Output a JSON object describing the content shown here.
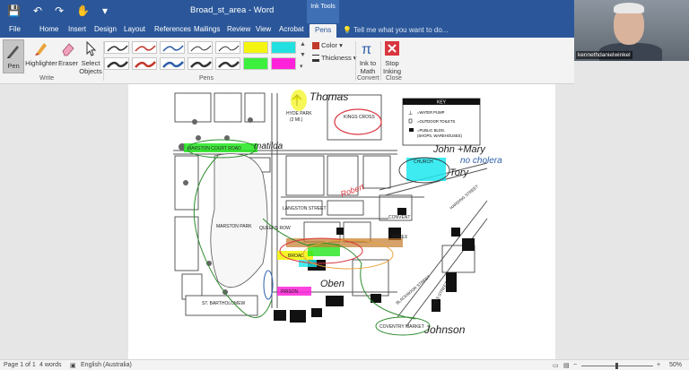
{
  "titlebar": {
    "doc_title": "Broad_st_area - Word",
    "context_tab": "Ink Tools",
    "qat": {
      "save": "💾",
      "undo": "↶",
      "redo": "↷",
      "touch": "✋",
      "more": "▾"
    }
  },
  "tabs": [
    "File",
    "Home",
    "Insert",
    "Design",
    "Layout",
    "References",
    "Mailings",
    "Review",
    "View",
    "Acrobat",
    "Pens"
  ],
  "active_tab": "Pens",
  "tellme": "Tell me what you want to do...",
  "ribbon": {
    "write": {
      "pen": "Pen",
      "highlighter": "Highlighter",
      "eraser": "Eraser",
      "select_objects": "Select Objects",
      "label": "Write"
    },
    "pens": {
      "label": "Pens",
      "colors": [
        "#333333",
        "#c0392b",
        "#2e5fa8",
        "#333333",
        "#f4f411",
        "#333333",
        "#c0392b",
        "#2e5fa8",
        "#333333",
        "#ff22d8"
      ]
    },
    "color": "Color",
    "thickness": "Thickness",
    "convert": {
      "ink_to_math": "Ink to Math",
      "label": "Convert"
    },
    "close": {
      "stop_inking": "Stop Inking",
      "label": "Close"
    }
  },
  "webcam": {
    "name": "kennethdanielwinkel"
  },
  "map": {
    "hyde_park": "HYDE PARK",
    "hyde_park_dist": "(2 MI.)",
    "kings_cross": "KINGS CROSS",
    "marston_court_road": "MARSTON COURT ROAD",
    "marston_park": "MARSTON PARK",
    "queens_row": "QUEENS ROW",
    "langston_street": "LANGSTON STREET",
    "convent": "CONVENT",
    "annex": "ANNEX",
    "church": "CHURCH",
    "broad": "BROAD",
    "prison": "PRISON",
    "st_bartholomew": "ST. BARTHOLOMEW",
    "coventry_market": "COVENTRY MARKET",
    "harding_street": "HARDING STREET",
    "blackmoor": "BLACKMOOR STREET",
    "gibbs_street": "GIBBS STREET",
    "key": {
      "title": "KEY",
      "items": [
        "=WATER PUMP",
        "=OUTDOOR TOILETS",
        "=PUBLIC BLDG.",
        "(SHOPS, WAREHOUSES)"
      ]
    },
    "ink": {
      "thomas": "Thomas",
      "matilda": "matilda",
      "john_mary": "John +Mary",
      "no_cholera": "no cholera",
      "tory": "Tory",
      "robert": "Robert",
      "oben": "Oben",
      "johnson": "Johnson"
    }
  },
  "status": {
    "page": "Page 1 of 1",
    "words": "4 words",
    "language": "English (Australia)",
    "zoom": "50%"
  }
}
